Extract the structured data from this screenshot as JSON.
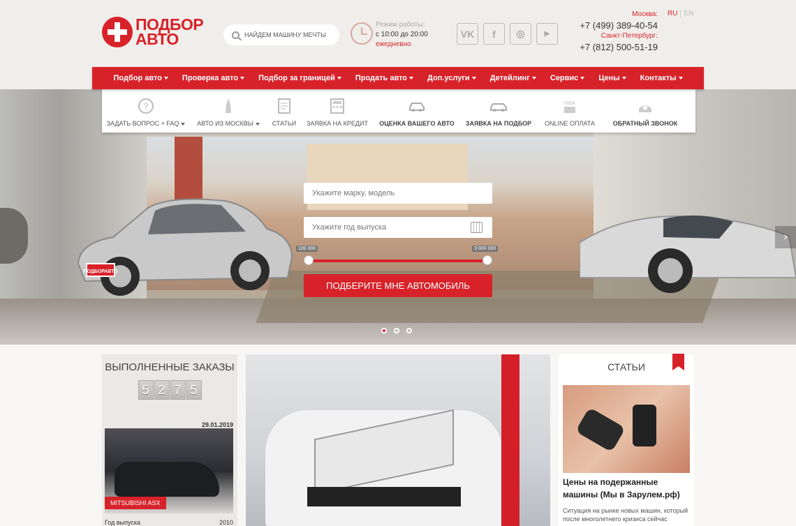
{
  "logo": {
    "line1": "ПОДБОР",
    "line2": "АВТО"
  },
  "search": {
    "placeholder": "НАЙДЕМ МАШИНУ МЕЧТЫ"
  },
  "hours": {
    "label": "Режим работы:",
    "time": "с 10:00 до 20:00",
    "days": "ежедневно"
  },
  "social": [
    {
      "name": "vk-icon",
      "glyph": "VK"
    },
    {
      "name": "facebook-icon",
      "glyph": "f"
    },
    {
      "name": "instagram-icon",
      "glyph": "◎"
    },
    {
      "name": "youtube-icon",
      "glyph": "▶"
    }
  ],
  "phones": {
    "city1": "Москва:",
    "phone1": "+7 (499) 389-40-54",
    "city2": "Санкт-Петербург:",
    "phone2": "+7 (812) 500-51-19"
  },
  "langs": {
    "ru": "RU",
    "en": "EN"
  },
  "nav": [
    {
      "label": "Подбор авто"
    },
    {
      "label": "Проверка авто"
    },
    {
      "label": "Подбор за границей"
    },
    {
      "label": "Продать авто"
    },
    {
      "label": "Доп.услуги"
    },
    {
      "label": "Детейлинг"
    },
    {
      "label": "Сервис"
    },
    {
      "label": "Цены"
    },
    {
      "label": "Контакты"
    }
  ],
  "subnav": [
    {
      "label": "ЗАДАТЬ ВОПРОС + FAQ",
      "icon": "question-icon",
      "caret": true,
      "bold": false
    },
    {
      "label": "АВТО ИЗ МОСКВЫ",
      "icon": "tower-icon",
      "caret": true,
      "bold": false
    },
    {
      "label": "СТАТЬИ",
      "icon": "document-icon",
      "caret": false,
      "bold": false
    },
    {
      "label": "ЗАЯВКА НА КРЕДИТ",
      "icon": "calculator-icon",
      "caret": false,
      "bold": false
    },
    {
      "label": "ОЦЕНКА ВАШЕГО АВТО",
      "icon": "car-hand-icon",
      "caret": false,
      "bold": true
    },
    {
      "label": "ЗАЯВКА НА ПОДБОР",
      "icon": "car-icon",
      "caret": false,
      "bold": true
    },
    {
      "label": "ONLINE ОПЛАТА",
      "icon": "card-icon",
      "caret": false,
      "bold": false
    },
    {
      "label": "ОБРАТНЫЙ ЗВОНОК",
      "icon": "phone-icon",
      "caret": false,
      "bold": true
    }
  ],
  "hero": {
    "brand_placeholder": "Укажите марку, модель",
    "year_placeholder": "Укажите год выпуска",
    "price_min": "100 000",
    "price_max": "3 000 000",
    "cta": "ПОДБЕРИТЕ МНЕ АВТОМОБИЛЬ",
    "plate": "ПОДБОРАВТО",
    "slides_active": 0
  },
  "orders": {
    "title": "ВЫПОЛНЕННЫЕ ЗАКАЗЫ",
    "digits": [
      "5",
      "2",
      "7",
      "5"
    ],
    "date": "29.01.2019",
    "car": "MITSUBISHI ASX",
    "row_label": "Год выпуска",
    "row_value": "2010"
  },
  "articles": {
    "title": "СТАТЬИ",
    "heading": "Цены на подержанные машины (Мы в Зарулем.рф)",
    "excerpt": "Ситуация на рынке новых машин, который после многолетнего кризиса сейчас"
  },
  "colors": {
    "accent": "#d8222a"
  }
}
